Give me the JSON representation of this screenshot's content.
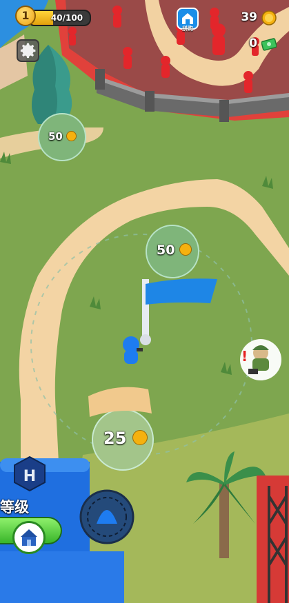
{
  "hud": {
    "level": "1",
    "xp_text": "40/100",
    "xp_fraction": 0.4,
    "gold": "39",
    "cash": "0"
  },
  "shop_label": "拼购",
  "prices": {
    "top_left": "50",
    "center": "50",
    "bottom": "25"
  },
  "hq": {
    "letter": "H",
    "level_label": "等级"
  },
  "colors": {
    "grass": "#7da84f",
    "path": "#f3d4a4",
    "enemy": "#e3262b",
    "player": "#1e7cf0",
    "gold": "#f5b10f",
    "cash": "#3cc25a"
  }
}
